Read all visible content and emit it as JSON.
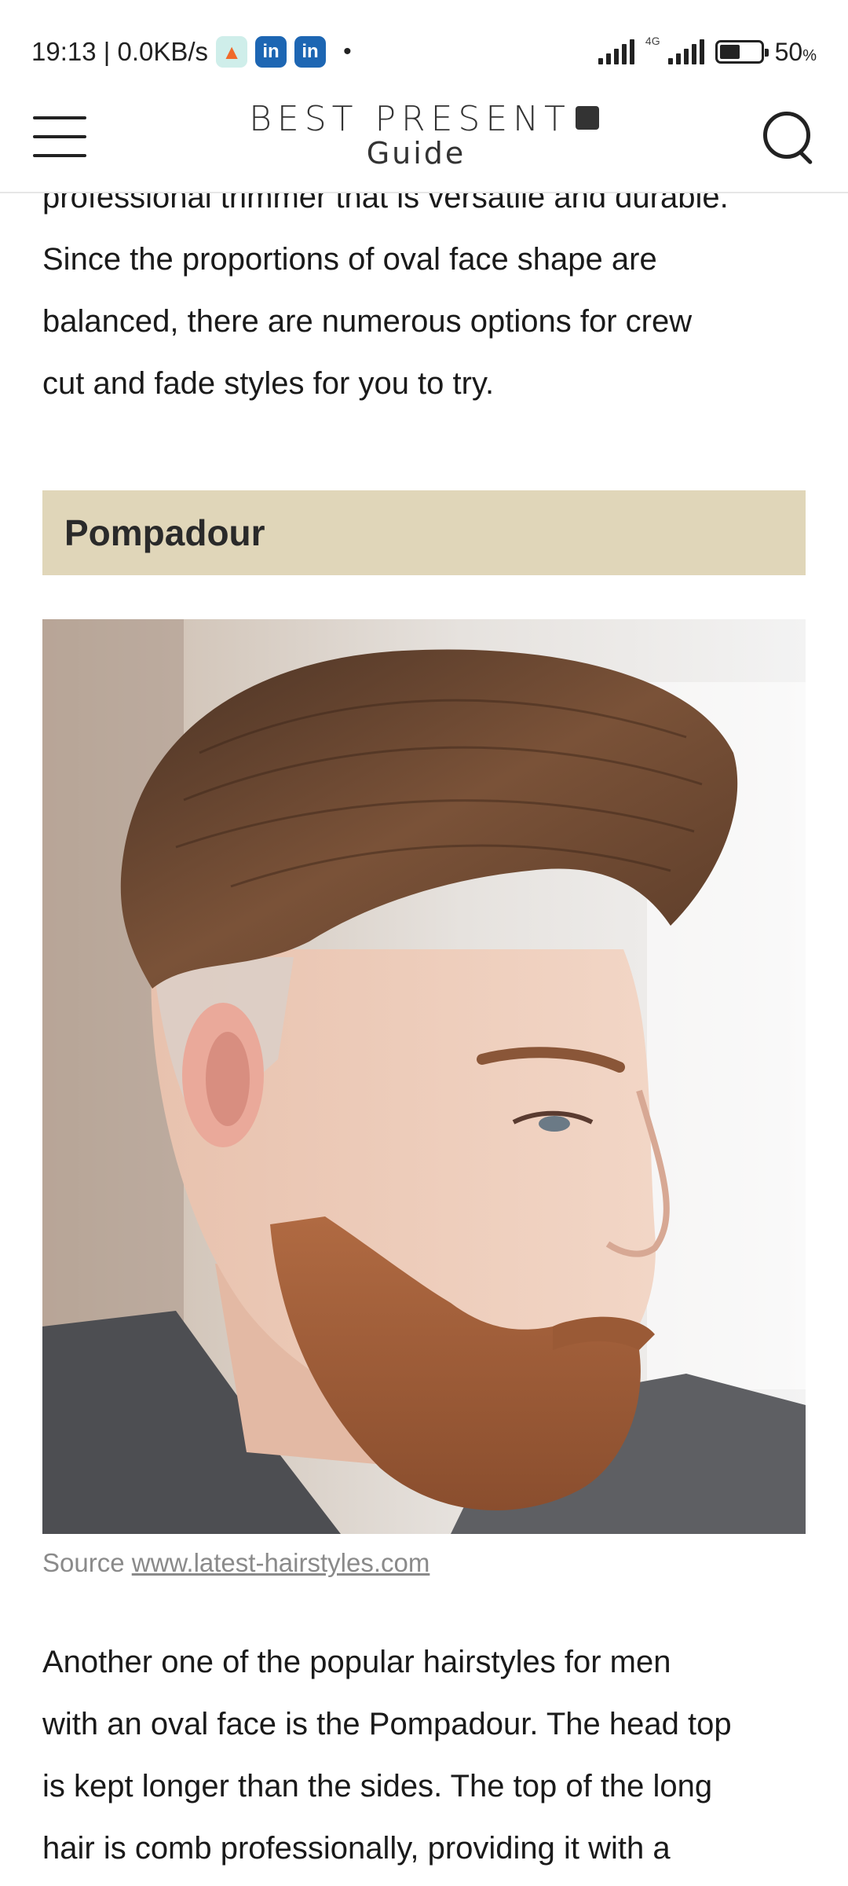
{
  "status_bar": {
    "time_speed": "19:13 | 0.0KB/s",
    "network_type": "4G",
    "battery_level": 0.5,
    "battery_percent": "50",
    "battery_unit": "%",
    "icons": [
      "flame-app-icon",
      "linkedin-icon",
      "linkedin-icon",
      "signal-icon",
      "battery-icon"
    ]
  },
  "header": {
    "logo_line1": "BEST PRESENT",
    "logo_line2": "Guide"
  },
  "article": {
    "intro_lines": [
      "professional trimmer that is versatile and durable.",
      "Since the proportions of oval face shape are",
      "balanced, there are numerous options for crew",
      "cut and fade styles for you to try."
    ],
    "section_heading": "Pompadour",
    "caption_prefix": "Source ",
    "caption_link": "www.latest-hairstyles.com",
    "body_lines": [
      "Another one of the popular hairstyles for men",
      "with an oval face is the Pompadour. The head top",
      "is kept longer than the sides. The top of the long",
      "hair is comb professionally, providing it with a"
    ]
  },
  "colors": {
    "heading_bg": "#e0d6b9",
    "text": "#1a1a1a",
    "caption": "#8a8a8a"
  }
}
